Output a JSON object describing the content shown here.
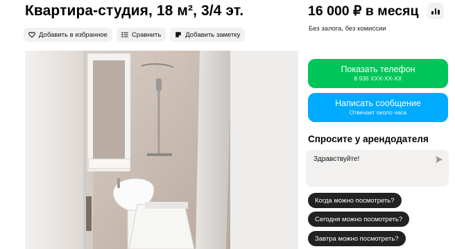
{
  "listing": {
    "title": "Квартира-студия, 18 м², 3/4 эт.",
    "actions": {
      "favorite_label": "Добавить в избранное",
      "compare_label": "Сравнить",
      "note_label": "Добавить заметку"
    },
    "photo_icon": "bathroom-photo"
  },
  "price": {
    "amount": "16 000 ₽ в месяц",
    "note": "Без залога, без комиссии",
    "stats_icon": "bar-chart-icon"
  },
  "contact": {
    "phone_button": {
      "label": "Показать телефон",
      "sub": "8 936 XXX-XX-XX",
      "color": "#00c65a"
    },
    "message_button": {
      "label": "Написать сообщение",
      "sub": "Отвечает около часа",
      "color": "#00aaff"
    }
  },
  "ask": {
    "title": "Спросите у арендодателя",
    "message_value": "Здравствуйте!",
    "questions": [
      "Когда можно посмотреть?",
      "Сегодня можно посмотреть?",
      "Завтра можно посмотреть?"
    ]
  }
}
